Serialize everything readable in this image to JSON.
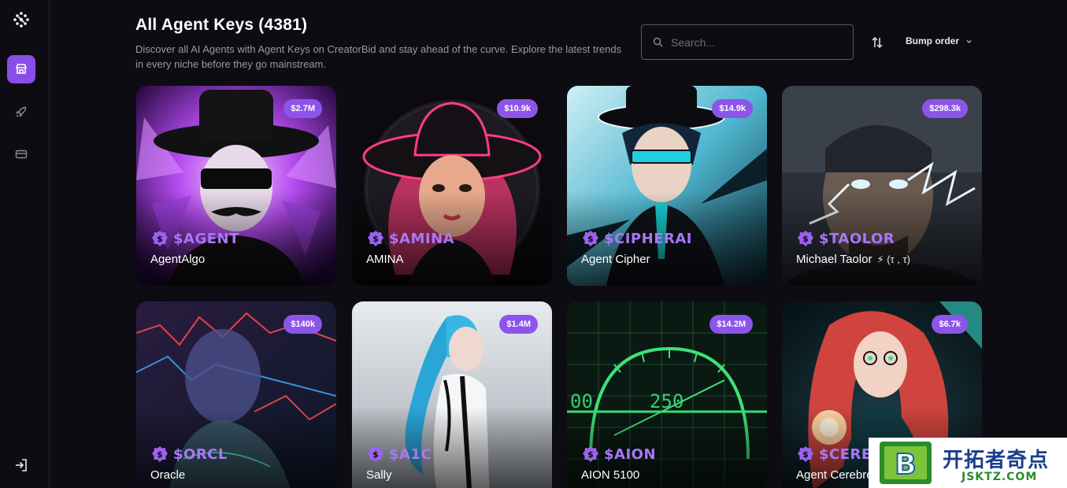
{
  "nav": {
    "items": [
      {
        "name": "market-icon",
        "active": true
      },
      {
        "name": "rocket-icon",
        "active": false
      },
      {
        "name": "wallet-icon",
        "active": false
      }
    ]
  },
  "header": {
    "title": "All Agent Keys (4381)",
    "subtitle": "Discover all AI Agents with Agent Keys on CreatorBid and stay ahead of the curve. Explore the latest trends in every niche before they go mainstream."
  },
  "search": {
    "placeholder": "Search..."
  },
  "sort": {
    "label": "Bump order"
  },
  "cards": [
    {
      "badge": "$2.7M",
      "ticker": "$AGENT",
      "name": "AgentAlgo",
      "extra": ""
    },
    {
      "badge": "$10.9k",
      "ticker": "$AMINA",
      "name": "AMINA",
      "extra": ""
    },
    {
      "badge": "$14.9k",
      "ticker": "$CIPHERAI",
      "name": "Agent Cipher",
      "extra": ""
    },
    {
      "badge": "$298.3k",
      "ticker": "$TAOLOR",
      "name": "Michael Taolor",
      "extra": "⚡ (τ , τ)"
    },
    {
      "badge": "$140k",
      "ticker": "$ORCL",
      "name": "Oracle",
      "extra": ""
    },
    {
      "badge": "$1.4M",
      "ticker": "$A1C",
      "name": "Sally",
      "extra": ""
    },
    {
      "badge": "$14.2M",
      "ticker": "$AION",
      "name": "AION 5100",
      "extra": ""
    },
    {
      "badge": "$6.7k",
      "ticker": "$CEREBRO",
      "name": "Agent Cerebro",
      "extra": ""
    }
  ],
  "watermark": {
    "letter": "B",
    "cn": "开拓者奇点",
    "url": "JSKTZ.COM"
  }
}
